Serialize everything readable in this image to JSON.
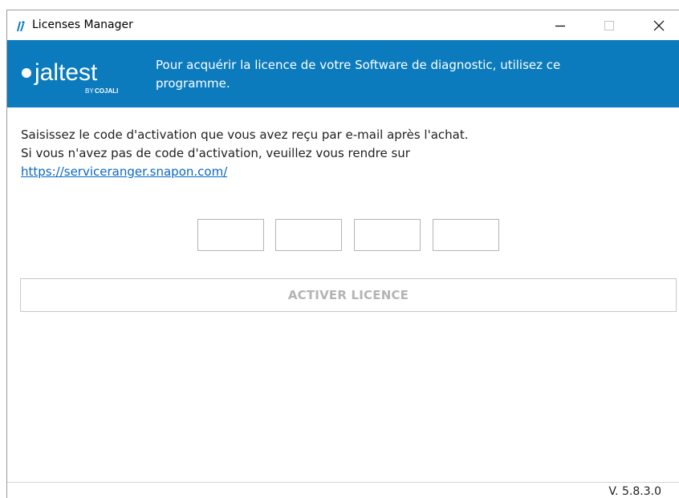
{
  "window": {
    "title": "Licenses Manager",
    "minimize_symbol": "—",
    "maximize_symbol": "☐",
    "close_symbol": "✕"
  },
  "header": {
    "logo_text": "jaltest",
    "logo_sub_prefix": "BY",
    "logo_sub_brand": "COJALI",
    "message_line1": "Pour acquérir la licence de votre Software de diagnostic, utilisez ce",
    "message_line2": "programme."
  },
  "instructions": {
    "line1": "Saisissez le code d'activation que vous avez reçu par e-mail après l'achat.",
    "line2": "Si vous n'avez pas de code d'activation, veuillez vous rendre sur",
    "link": "https://serviceranger.snapon.com/"
  },
  "activation_code": {
    "parts": [
      "",
      "",
      "",
      ""
    ]
  },
  "activate_button": {
    "label": "ACTIVER LICENCE"
  },
  "footer": {
    "version": "V. 5.8.3.0"
  },
  "colors": {
    "header_bg": "#0b7bbd",
    "link": "#0b66c2",
    "disabled_text": "#b4b4b4"
  }
}
